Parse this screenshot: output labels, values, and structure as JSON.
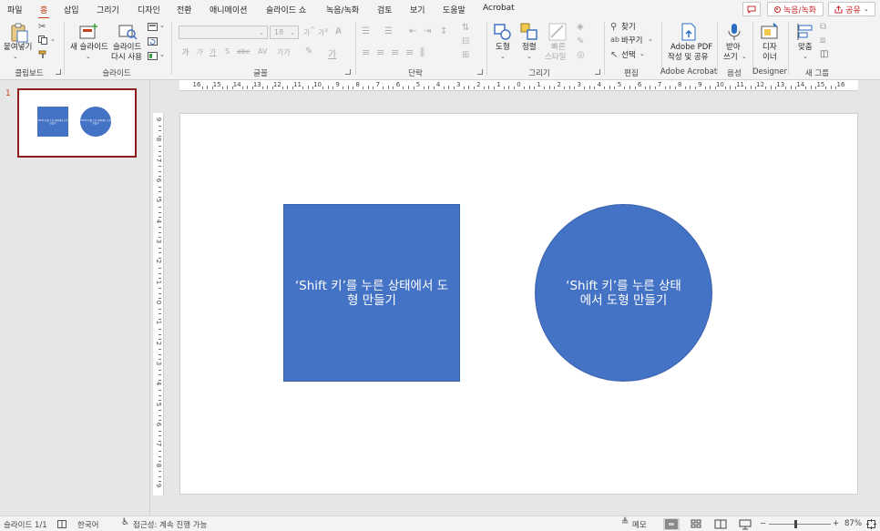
{
  "tabs": [
    "파일",
    "홈",
    "삽입",
    "그리기",
    "디자인",
    "전환",
    "애니메이션",
    "슬라이드 쇼",
    "녹음/녹화",
    "검토",
    "보기",
    "도움말",
    "Acrobat"
  ],
  "active_tab": "홈",
  "top_buttons": {
    "record": "녹음/녹화",
    "share": "공유"
  },
  "ribbon": {
    "groups": {
      "clipboard": "클립보드",
      "slides": "슬라이드",
      "font": "글꼴",
      "paragraph": "단락",
      "drawing": "그리기",
      "editing": "편집",
      "adobe": "Adobe Acrobat",
      "voice": "음성",
      "designer": "Designer",
      "new_group": "새 그룹"
    },
    "paste": "붙여넣기",
    "new_slide": "새 슬라이드",
    "reuse_slides_1": "슬라이드",
    "reuse_slides_2": "다시 사용",
    "font_size": "18",
    "shapes": "도형",
    "arrange": "정렬",
    "quick_styles_1": "빠른",
    "quick_styles_2": "스타일",
    "find": "찾기",
    "replace": "바꾸기",
    "select": "선택",
    "adobe_pdf_1": "Adobe PDF",
    "adobe_pdf_2": "작성 및 공유",
    "dictate_1": "받아",
    "dictate_2": "쓰기",
    "designer_1": "디자",
    "designer_2": "이너",
    "align": "맞춤"
  },
  "ruler": {
    "h_labels": [
      "16",
      "15",
      "14",
      "13",
      "12",
      "11",
      "10",
      "9",
      "8",
      "7",
      "6",
      "5",
      "4",
      "3",
      "2",
      "1",
      "0",
      "1",
      "2",
      "3",
      "4",
      "5",
      "6",
      "7",
      "8",
      "9",
      "10",
      "11",
      "12",
      "13",
      "14",
      "15",
      "16"
    ],
    "v_labels": [
      "9",
      "8",
      "7",
      "6",
      "5",
      "4",
      "3",
      "2",
      "1",
      "0",
      "1",
      "2",
      "3",
      "4",
      "5",
      "6",
      "7",
      "8",
      "9"
    ]
  },
  "thumbnail": {
    "number": "1",
    "square_text": "'Shift 키'를 누른 상태에서 도형 만들기",
    "circle_text": "'Shift 키'를 누른 상태에서 도형 만들기"
  },
  "slide": {
    "square_text": "‘Shift 키’를 누른 상태에서 도형 만들기",
    "circle_text": "‘Shift 키’를 누른 상태에서 도형 만들기"
  },
  "status": {
    "slide_count": "슬라이드 1/1",
    "language": "한국어",
    "accessibility": "접근성: 계속 진행 가능",
    "notes": "메모",
    "zoom_level": "87%",
    "zoom_minus": "−",
    "zoom_plus": "+"
  },
  "colors": {
    "accent": "#c43e1c",
    "shape_fill": "#4472c4",
    "thumb_border": "#8c1b1b"
  }
}
